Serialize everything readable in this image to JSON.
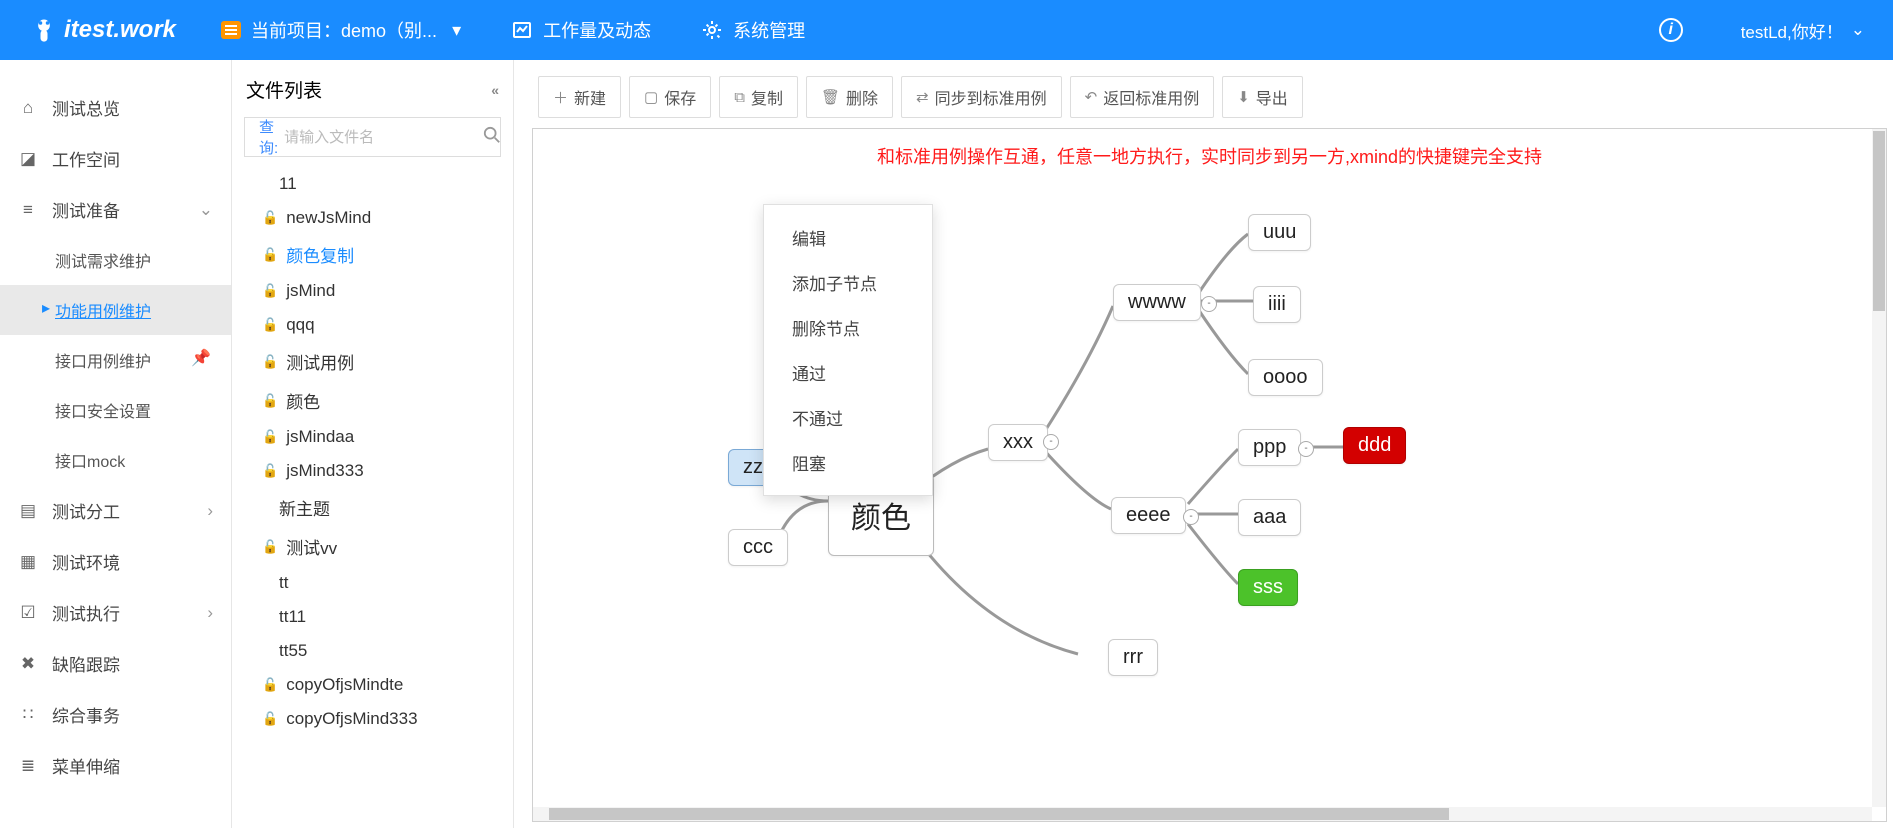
{
  "topbar": {
    "logo": "itest.work",
    "project_label": "当前项目：demo（别...",
    "workload": "工作量及动态",
    "sysmgmt": "系统管理",
    "greeting": "testLd,你好！"
  },
  "sidenav": {
    "items": [
      {
        "label": "测试总览",
        "icon": "home"
      },
      {
        "label": "工作空间",
        "icon": "box"
      },
      {
        "label": "测试准备",
        "icon": "tune",
        "expanded": true,
        "children": [
          {
            "label": "测试需求维护"
          },
          {
            "label": "功能用例维护",
            "active": true
          },
          {
            "label": "接口用例维护",
            "pinned": true
          },
          {
            "label": "接口安全设置"
          },
          {
            "label": "接口mock"
          }
        ]
      },
      {
        "label": "测试分工",
        "icon": "assign",
        "chev": true
      },
      {
        "label": "测试环境",
        "icon": "env"
      },
      {
        "label": "测试执行",
        "icon": "exec",
        "chev": true
      },
      {
        "label": "缺陷跟踪",
        "icon": "bug"
      },
      {
        "label": "综合事务",
        "icon": "misc"
      },
      {
        "label": "菜单伸缩",
        "icon": "fold"
      }
    ]
  },
  "filepane": {
    "title": "文件列表",
    "search_label": "查询:",
    "search_placeholder": "请输入文件名",
    "files": [
      {
        "name": "11",
        "lock": false
      },
      {
        "name": "newJsMind",
        "lock": true
      },
      {
        "name": "颜色复制",
        "lock": true,
        "selected": true
      },
      {
        "name": "jsMind",
        "lock": true
      },
      {
        "name": "qqq",
        "lock": true
      },
      {
        "name": "测试用例",
        "lock": true
      },
      {
        "name": "颜色",
        "lock": true
      },
      {
        "name": "jsMindaa",
        "lock": true
      },
      {
        "name": "jsMind333",
        "lock": true
      },
      {
        "name": "新主题",
        "lock": false
      },
      {
        "name": "测试vv",
        "lock": true
      },
      {
        "name": "tt",
        "lock": false
      },
      {
        "name": "tt11",
        "lock": false
      },
      {
        "name": "tt55",
        "lock": false
      },
      {
        "name": "copyOfjsMindte",
        "lock": true
      },
      {
        "name": "copyOfjsMind333",
        "lock": true
      }
    ]
  },
  "toolbar": {
    "new": "新建",
    "save": "保存",
    "copy": "复制",
    "delete": "删除",
    "sync": "同步到标准用例",
    "back": "返回标准用例",
    "export": "导出"
  },
  "canvas": {
    "notice": "和标准用例操作互通，任意一地方执行，实时同步到另一方,xmind的快捷键完全支持"
  },
  "context_menu": {
    "items": [
      "编辑",
      "添加子节点",
      "删除节点",
      "通过",
      "不通过",
      "阻塞"
    ]
  },
  "mindmap": {
    "root": "颜色",
    "left": [
      "zzz",
      "ccc"
    ],
    "right": [
      {
        "label": "xxx",
        "children": [
          {
            "label": "wwww",
            "children": [
              {
                "label": "uuu"
              },
              {
                "label": "iiii"
              },
              {
                "label": "oooo"
              }
            ]
          },
          {
            "label": "eeee",
            "children": [
              {
                "label": "ppp",
                "children": [
                  {
                    "label": "ddd",
                    "color": "red"
                  }
                ]
              },
              {
                "label": "aaa"
              },
              {
                "label": "sss",
                "color": "green"
              }
            ]
          }
        ]
      },
      {
        "label": "rrr"
      }
    ]
  }
}
